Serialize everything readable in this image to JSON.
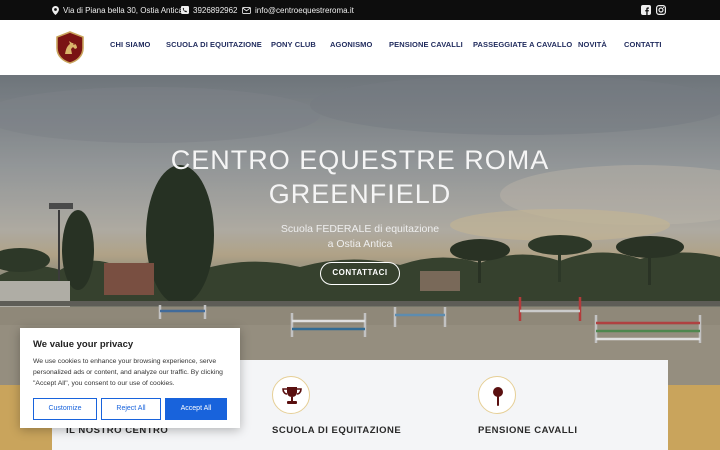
{
  "topbar": {
    "address": "Via di Piana bella 30, Ostia Antica",
    "phone": "3926892962",
    "email": "info@centroequestreroma.it",
    "icons": [
      "location-pin-icon",
      "phone-icon",
      "envelope-icon",
      "facebook-icon",
      "instagram-icon"
    ]
  },
  "nav": {
    "items": [
      {
        "label": "CHI SIAMO"
      },
      {
        "label": "SCUOLA DI EQUITAZIONE"
      },
      {
        "label": "PONY CLUB"
      },
      {
        "label": "AGONISMO"
      },
      {
        "label": "PENSIONE CAVALLI"
      },
      {
        "label": "PASSEGGIATE A CAVALLO"
      },
      {
        "label": "NOVITÀ"
      },
      {
        "label": "CONTATTI"
      }
    ]
  },
  "hero": {
    "title_line1": "CENTRO EQUESTRE ROMA",
    "title_line2": "GREENFIELD",
    "subtitle_line1": "Scuola FEDERALE di equitazione",
    "subtitle_line2": "a Ostia Antica",
    "cta": "CONTATTACI"
  },
  "features": [
    {
      "label": "IL NOSTRO CENTRO",
      "icon": "stable-icon"
    },
    {
      "label": "SCUOLA DI EQUITAZIONE",
      "icon": "trophy-icon"
    },
    {
      "label": "PENSIONE CAVALLI",
      "icon": "horse-brush-icon"
    }
  ],
  "cookie": {
    "title": "We value your privacy",
    "text": "We use cookies to enhance your browsing experience, serve personalized ads or content, and analyze our traffic. By clicking \"Accept All\", you consent to our use of cookies.",
    "customize": "Customize",
    "reject": "Reject All",
    "accept": "Accept All"
  },
  "colors": {
    "topbar_bg": "#0d0d0d",
    "nav_text": "#1f2a5c",
    "gold_band": "#c9a45c",
    "cookie_accent": "#1863dc"
  }
}
